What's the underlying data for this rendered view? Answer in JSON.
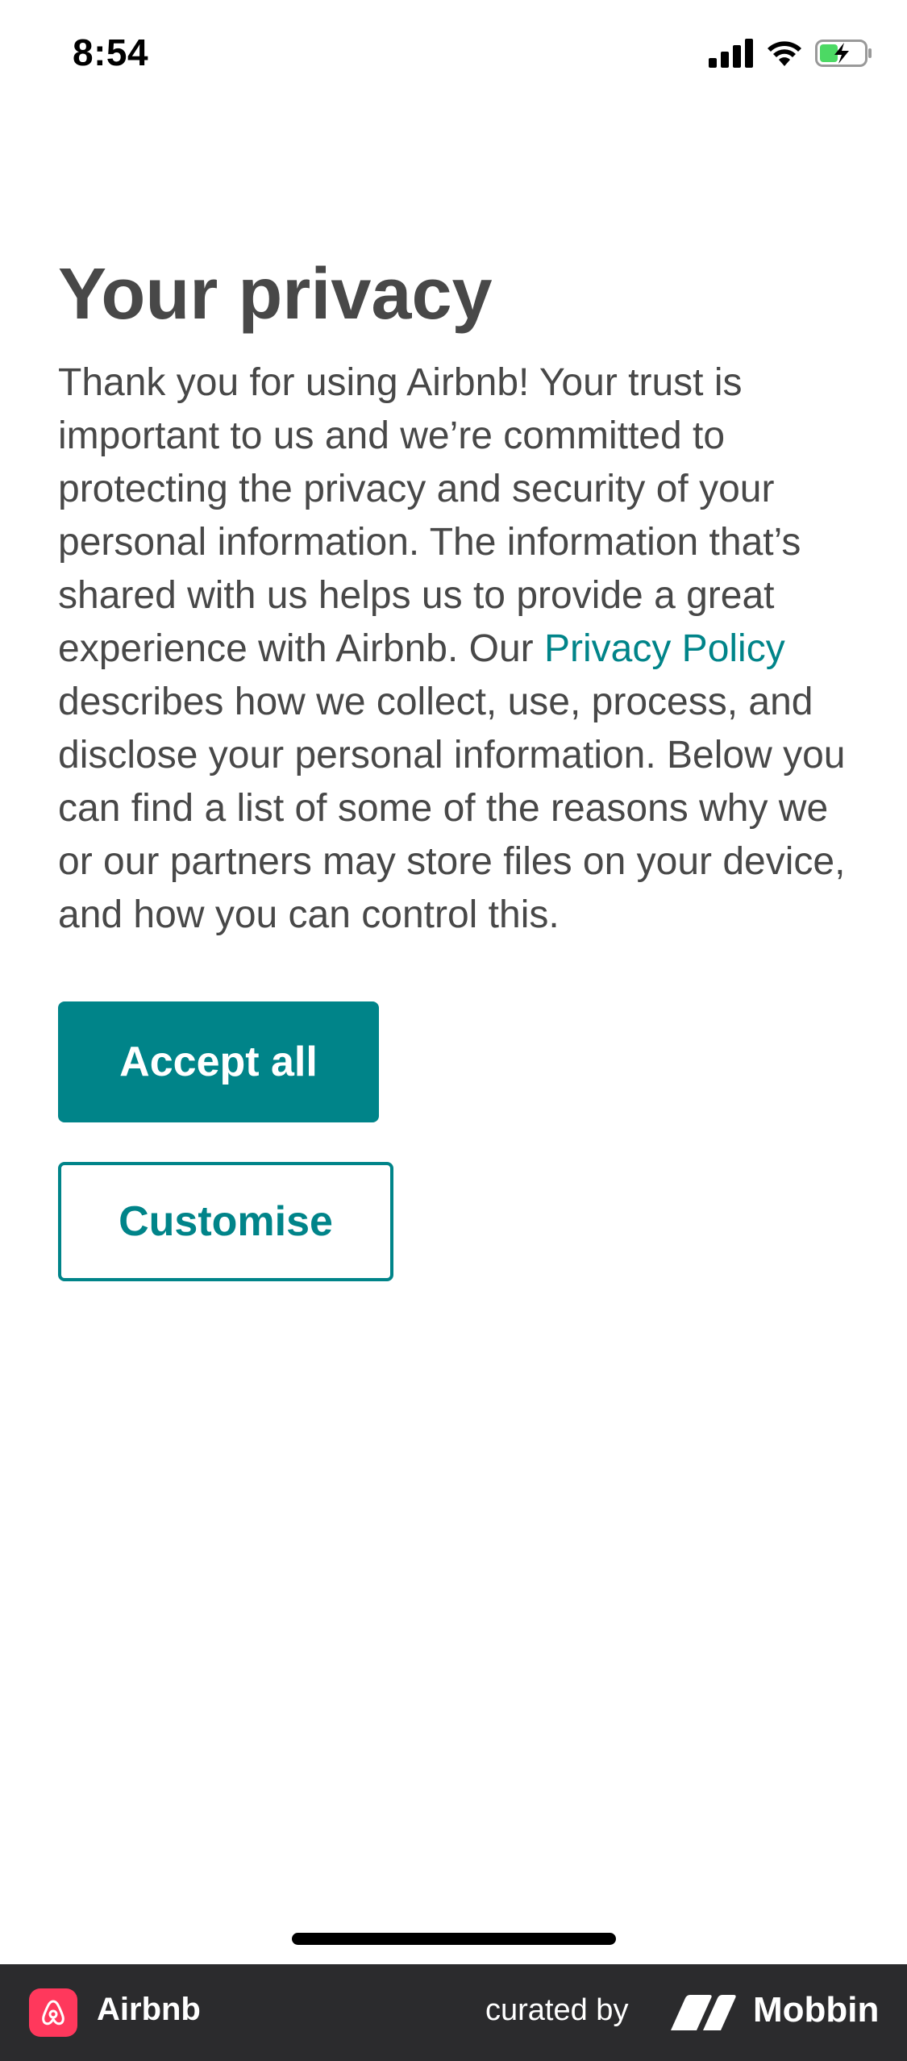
{
  "status_bar": {
    "time": "8:54"
  },
  "privacy": {
    "title": "Your privacy",
    "body_before_link": "Thank you for using Airbnb! Your trust is important to us and we’re committed to protecting the privacy and security of your personal information. The information that’s shared with us helps us to provide a great experience with Airbnb. Our ",
    "link_label": "Privacy Policy",
    "body_after_link": " describes how we collect, use, process, and disclose your personal information. Below you can find a list of some of the reasons why we or our partners may store files on your device, and how you can control this.",
    "accept_label": "Accept all",
    "customise_label": "Customise"
  },
  "footer": {
    "app_name": "Airbnb",
    "curated_by": "curated by",
    "brand": "Mobbin"
  },
  "colors": {
    "accent": "#008489",
    "text": "#484848",
    "footer_bg": "#2b2b2d",
    "airbnb_brand": "#ff385c"
  },
  "icons": {
    "status": [
      "signal-icon",
      "wifi-icon",
      "battery-charging-icon"
    ],
    "footer": [
      "airbnb-logo-icon",
      "mobbin-logo-icon"
    ]
  }
}
